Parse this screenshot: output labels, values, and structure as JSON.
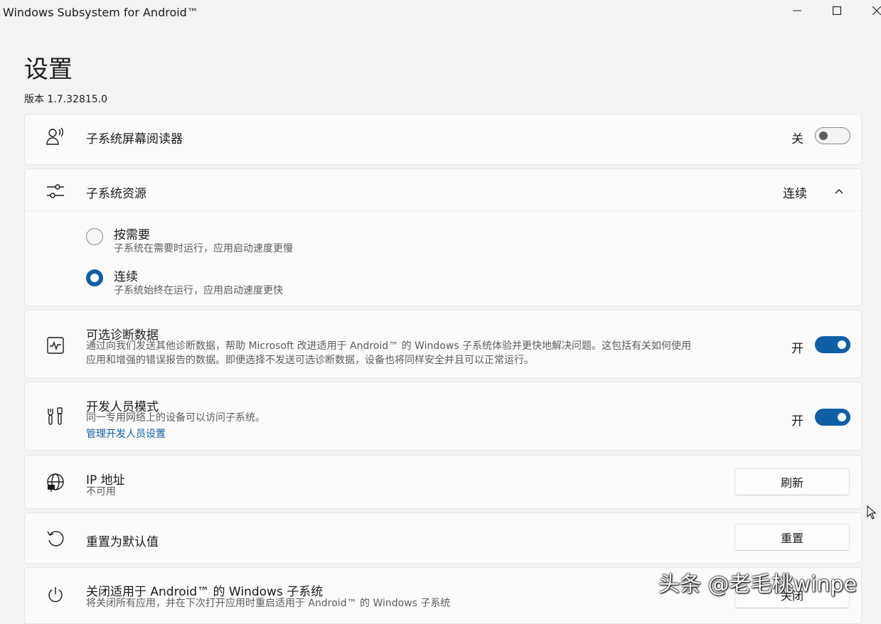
{
  "window": {
    "title": "Windows Subsystem for Android™"
  },
  "page": {
    "title": "设置",
    "version": "版本 1.7.32815.0"
  },
  "screen_reader": {
    "label": "子系统屏幕阅读器",
    "state": "关",
    "enabled": false,
    "icon": "screen-reader-icon"
  },
  "resources": {
    "label": "子系统资源",
    "selected": "连续",
    "expanded": true,
    "icon": "sliders-icon",
    "options": [
      {
        "label": "按需要",
        "desc": "子系统在需要时运行，应用启动速度更慢",
        "checked": false
      },
      {
        "label": "连续",
        "desc": "子系统始终在运行，应用启动速度更快",
        "checked": true
      }
    ]
  },
  "diagnostics": {
    "label": "可选诊断数据",
    "desc_line1": "通过向我们发送其他诊断数据，帮助 Microsoft 改进适用于 Android™ 的 Windows 子系统体验并更快地解决问题。这包括有关如何使用",
    "desc_line2": "应用和增强的错误报告的数据。即便选择不发送可选诊断数据，设备也将同样安全并且可以正常运行。",
    "state": "开",
    "enabled": true,
    "icon": "activity-icon"
  },
  "developer": {
    "label": "开发人员模式",
    "desc": "同一专用网络上的设备可以访问子系统。",
    "link": "管理开发人员设置",
    "state": "开",
    "enabled": true,
    "icon": "developer-tools-icon"
  },
  "ip": {
    "label": "IP 地址",
    "desc": "不可用",
    "button": "刷新",
    "icon": "globe-network-icon"
  },
  "reset": {
    "label": "重置为默认值",
    "button": "重置",
    "icon": "reset-icon"
  },
  "shutdown": {
    "label": "关闭适用于 Android™ 的 Windows 子系统",
    "desc": "将关闭所有应用，并在下次打开应用时重启适用于 Android™ 的 Windows 子系统",
    "button": "关闭",
    "icon": "power-icon"
  },
  "watermark": "头条 @老毛桃winpe",
  "colors": {
    "accent": "#0f5fa6",
    "background": "#f3f3f3",
    "card": "#fbfbfb"
  }
}
